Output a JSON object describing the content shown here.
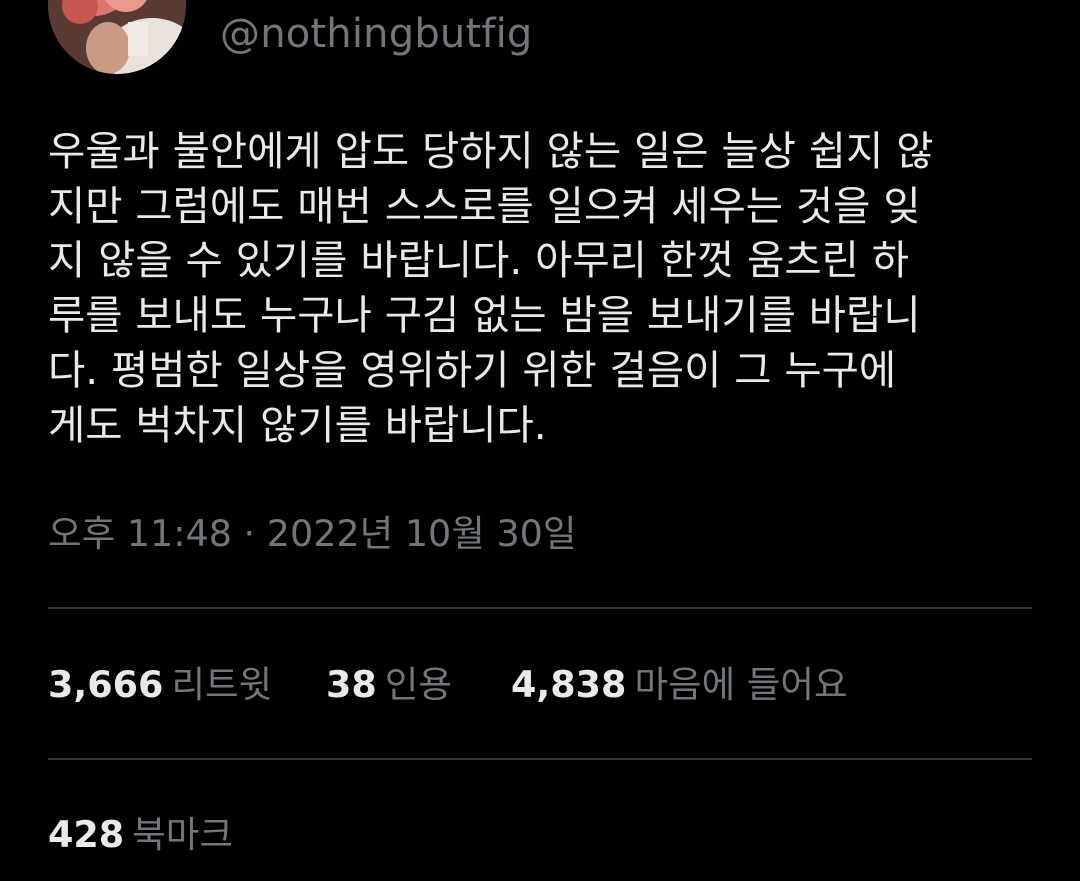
{
  "tweet": {
    "handle": "@nothingbutfig",
    "text": "우울과 불안에게 압도 당하지 않는 일은 늘상 쉽지 않\n지만 그럼에도 매번 스스로를 일으켜 세우는 것을 잊\n지 않을 수 있기를 바랍니다. 아무리 한껏 움츠린 하\n루를 보내도 누구나 구김 없는 밤을 보내기를 바랍니\n다. 평범한 일상을 영위하기 위한 걸음이 그 누구에\n게도 벅차지 않기를 바랍니다.",
    "timestamp": "오후 11:48 · 2022년 10월 30일"
  },
  "stats": {
    "retweets": {
      "count": "3,666",
      "label": "리트윗"
    },
    "quotes": {
      "count": "38",
      "label": "인용"
    },
    "likes": {
      "count": "4,838",
      "label": "마음에 들어요"
    },
    "bookmarks": {
      "count": "428",
      "label": "북마크"
    }
  },
  "colors": {
    "background": "#000000",
    "primary_text": "#e7e9ea",
    "secondary_text": "#71767b",
    "divider": "#2f3336"
  },
  "icons": {
    "avatar": "profile-photo"
  }
}
